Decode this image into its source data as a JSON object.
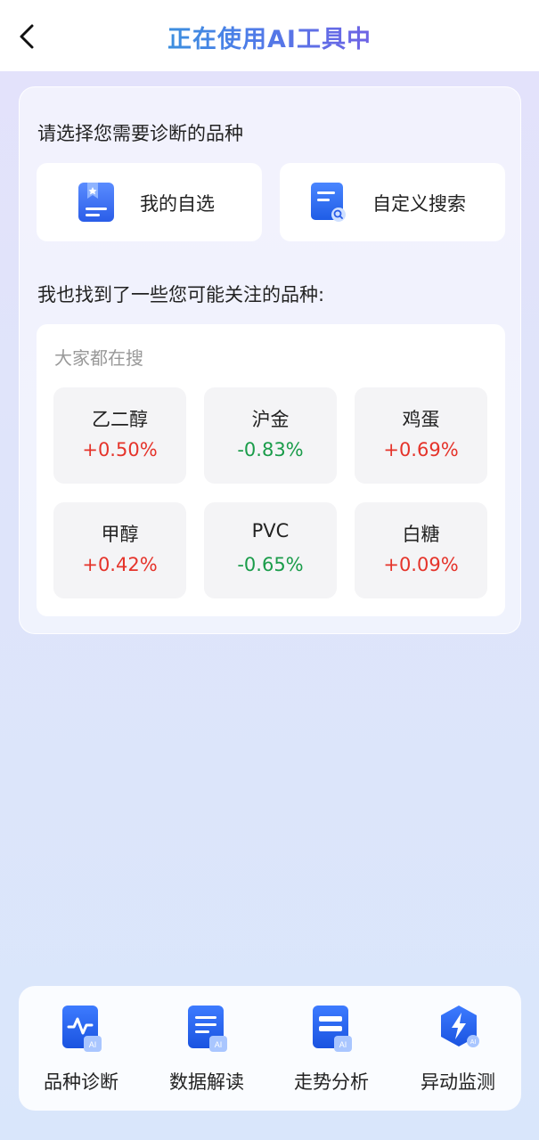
{
  "header": {
    "title": "正在使用AI工具中",
    "back_icon": "chevron-left-icon"
  },
  "select_section": {
    "label": "请选择您需要诊断的品种",
    "options": [
      {
        "label": "我的自选",
        "icon": "bookmark-list-icon"
      },
      {
        "label": "自定义搜索",
        "icon": "document-search-icon"
      }
    ]
  },
  "suggest_section": {
    "label": "我也找到了一些您可能关注的品种:",
    "hot_title": "大家都在搜",
    "items": [
      {
        "name": "乙二醇",
        "change": "+0.50%",
        "direction": "up"
      },
      {
        "name": "沪金",
        "change": "-0.83%",
        "direction": "down"
      },
      {
        "name": "鸡蛋",
        "change": "+0.69%",
        "direction": "up"
      },
      {
        "name": "甲醇",
        "change": "+0.42%",
        "direction": "up"
      },
      {
        "name": "PVC",
        "change": "-0.65%",
        "direction": "down"
      },
      {
        "name": "白糖",
        "change": "+0.09%",
        "direction": "up"
      }
    ]
  },
  "tools": [
    {
      "label": "品种诊断",
      "icon": "pulse-ai-icon"
    },
    {
      "label": "数据解读",
      "icon": "document-ai-icon"
    },
    {
      "label": "走势分析",
      "icon": "card-ai-icon"
    },
    {
      "label": "异动监测",
      "icon": "lightning-hexagon-icon"
    }
  ],
  "colors": {
    "up": "#e5332a",
    "down": "#1a9c4a",
    "accent_blue": "#2f6ff0"
  }
}
